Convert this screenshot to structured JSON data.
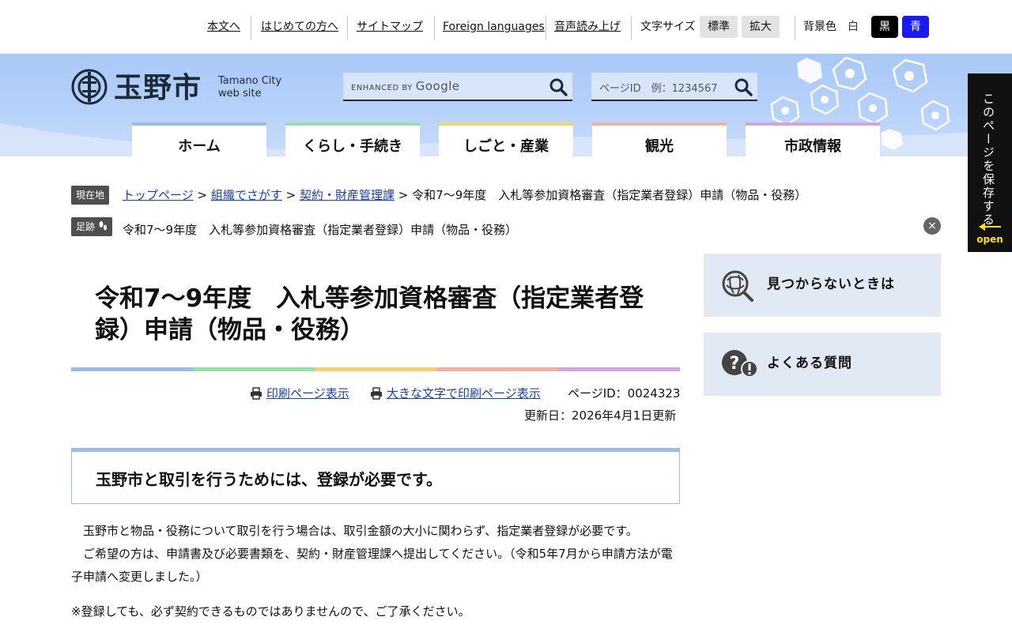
{
  "utility": {
    "links": [
      "本文へ",
      "はじめての方へ",
      "サイトマップ",
      "Foreign languages",
      "音声読み上げ"
    ],
    "font_size_label": "文字サイズ",
    "font_size_buttons": [
      "標準",
      "拡大"
    ],
    "bg_label": "背景色",
    "bg_buttons": [
      "白",
      "黒",
      "青"
    ],
    "bg_colors": {
      "white": "#ffffff",
      "black": "#000000",
      "blue": "#1a1af5"
    }
  },
  "header": {
    "logo_text": "玉野市",
    "logo_sub_1": "Tamano City",
    "logo_sub_2": "web site",
    "google_label": "ENHANCED BY",
    "google_brand": "Google",
    "pageid_placeholder": "ページID　例：1234567",
    "bg_color": "#a9c8f7"
  },
  "nav": {
    "tabs": [
      {
        "label": "ホーム",
        "color": "#9cbbe8"
      },
      {
        "label": "くらし・手続き",
        "color": "#94e0a8"
      },
      {
        "label": "しごと・産業",
        "color": "#f5d36b"
      },
      {
        "label": "観光",
        "color": "#f7aea0"
      },
      {
        "label": "市政情報",
        "color": "#d4a3e0"
      }
    ]
  },
  "breadcrumb": {
    "current_tag": "現在地",
    "items": [
      "トップページ",
      "組織でさがす",
      "契約・財産管理課"
    ],
    "separator": ">",
    "current": "令和7～9年度　入札等参加資格審査（指定業者登録）申請（物品・役務）",
    "history_tag": "足跡",
    "history_item": "令和7～9年度　入札等参加資格審査（指定業者登録）申請（物品・役務）",
    "close_icon": "×"
  },
  "sidetab": {
    "text": "このページを保存する",
    "open_label": "open"
  },
  "main": {
    "title": "令和7～9年度　入札等参加資格審査（指定業者登録）申請（物品・役務）",
    "print_link": "印刷ページ表示",
    "print_large_link": "大きな文字で印刷ページ表示",
    "page_id": "ページID：0024323",
    "updated": "更新日：2026年4月1日更新",
    "section_heading": "玉野市と取引を行うためには、登録が必要です。",
    "para1": "　玉野市と物品・役務について取引を行う場合は、取引金額の大小に関わらず、指定業者登録が必要です。",
    "para2": "　ご希望の方は、申請書及び必要書類を、契約・財産管理課へ提出してください。（令和5年7月から申請方法が電子申請へ変更しました。）",
    "para3": "※登録しても、必ず契約できるものではありませんので、ご了承ください。"
  },
  "sidebar": {
    "boxes": [
      {
        "label": "見つからないときは",
        "icon": "search-help-icon"
      },
      {
        "label": "よくある質問",
        "icon": "faq-icon"
      }
    ]
  }
}
